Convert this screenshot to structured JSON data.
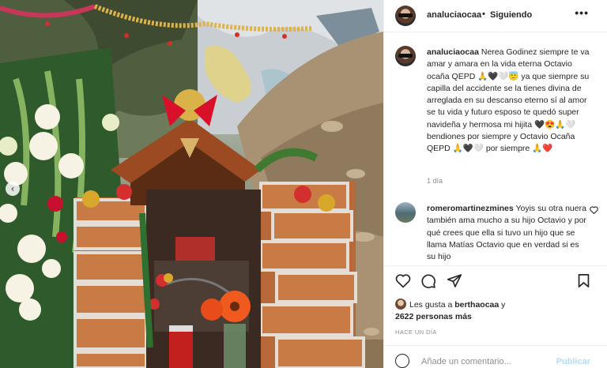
{
  "post": {
    "username": "analuciaocaa",
    "separator": "•",
    "follow_status": "Siguiendo",
    "more_label": "•••"
  },
  "comments": [
    {
      "author": "analuciaocaa",
      "text": "Nerea Godinez siempre te va amar y amara en la vida eterna Octavio ocaña QEPD 🙏🖤🤍😇 ya que siempre su capilla del accidente se la tienes divina de arreglada en su descanso eterno sí al amor se tu vida y futuro esposo te quedó super navideña y hermosa mi hijita 🖤😍🙏🤍 bendiones por siempre y Octavio Ocaña QEPD 🙏🖤🤍 por siempre 🙏❤️",
      "time": "1 día"
    },
    {
      "author": "romeromartinezmines",
      "text": "Yoyis su otra nuera también ama mucho a su hijo Octavio y por qué crees que ella si tuvo un hijo que se llama Matías Octavio que en verdad si es su hijo"
    }
  ],
  "likes": {
    "prefix": "Les gusta a",
    "user": "berthaocaa",
    "connector": "y",
    "others": "2622 personas más"
  },
  "timestamp": "HACE UN DÍA",
  "composer": {
    "placeholder": "Añade un comentario...",
    "post_label": "Publicar"
  },
  "carousel": {
    "prev_glyph": "‹"
  },
  "icons": [
    "heart-icon",
    "comment-icon",
    "share-icon",
    "bookmark-icon",
    "emoji-icon",
    "more-icon"
  ]
}
